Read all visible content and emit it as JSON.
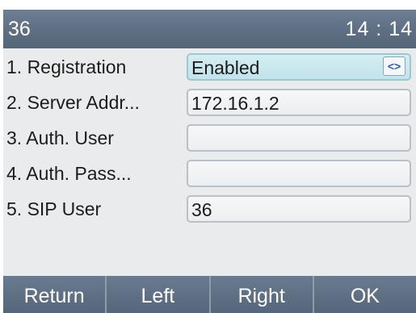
{
  "status": {
    "extension": "36",
    "time": "14 : 14"
  },
  "rows": [
    {
      "label": "1.  Registration",
      "value": "Enabled"
    },
    {
      "label": "2.  Server Addr...",
      "value": "172.16.1.2"
    },
    {
      "label": "3.  Auth. User",
      "value": ""
    },
    {
      "label": "4.  Auth. Pass...",
      "value": ""
    },
    {
      "label": "5.  SIP User",
      "value": "36"
    }
  ],
  "selector_icon": "left-right-arrows-icon",
  "softkeys": {
    "return": "Return",
    "left": "Left",
    "right": "Right",
    "ok": "OK"
  }
}
